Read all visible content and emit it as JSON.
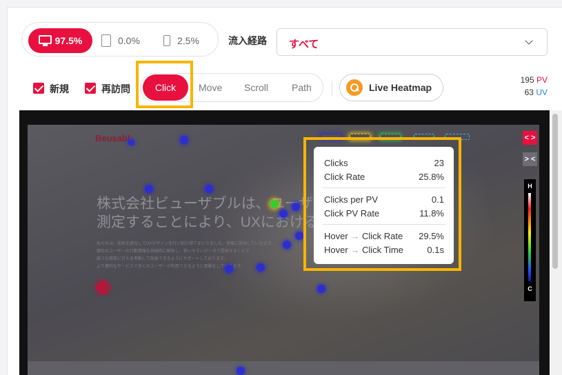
{
  "devices": [
    {
      "name": "desktop",
      "value": "97.5%",
      "active": true,
      "icon": "monitor-icon"
    },
    {
      "name": "tablet",
      "value": "0.0%",
      "icon": "tablet-icon"
    },
    {
      "name": "mobile",
      "value": "2.5%",
      "icon": "phone-icon"
    }
  ],
  "source": {
    "label": "流入経路",
    "value": "すべて"
  },
  "filters": [
    {
      "label": "新規",
      "checked": true
    },
    {
      "label": "再訪問",
      "checked": true
    }
  ],
  "modes": {
    "click": "Click",
    "move": "Move",
    "scroll": "Scroll",
    "path": "Path",
    "active": "Click"
  },
  "live_heatmap": "Live Heatmap",
  "stats": {
    "pv_value": "195",
    "pv_label": "PV",
    "uv_value": "63",
    "uv_label": "UV"
  },
  "page": {
    "logo": "Beusabl",
    "headline1": "株式会社ビューザブルは、ユーザーの",
    "headline2": "測定することにより、UXにおける影響",
    "copy": [
      "私たちは、技術を進化してUXデザインを行い知り得てまいりました。皆様に提供していきます。",
      "御社のユーザーの行動情報を詳細的に解析し、使いやすいデータで提供することで",
      "誰でも簡単に行える考動して改善できるようにサポートしております。",
      "より便利なサービスで多くのユーザーが利用できるように貢献をしていきます。"
    ]
  },
  "tooltip": {
    "clicks_label": "Clicks",
    "clicks_value": "23",
    "click_rate_label": "Click Rate",
    "click_rate_value": "25.8%",
    "clicks_per_pv_label": "Clicks per PV",
    "clicks_per_pv_value": "0.1",
    "click_pv_rate_label": "Click PV Rate",
    "click_pv_rate_value": "11.8%",
    "hover_label": "Hover",
    "hover_arrow": "→",
    "hover_click_rate_label": "Click Rate",
    "hover_click_rate_value": "29.5%",
    "hover_click_time_label": "Click Time",
    "hover_click_time_value": "0.1s"
  },
  "controls": {
    "expand": "< >",
    "collapse": "> <"
  },
  "legend": {
    "high": "H",
    "low": "C"
  },
  "colors": {
    "accent": "#e8103f",
    "uv": "#2f80d8",
    "highlight": "#f7b500"
  }
}
